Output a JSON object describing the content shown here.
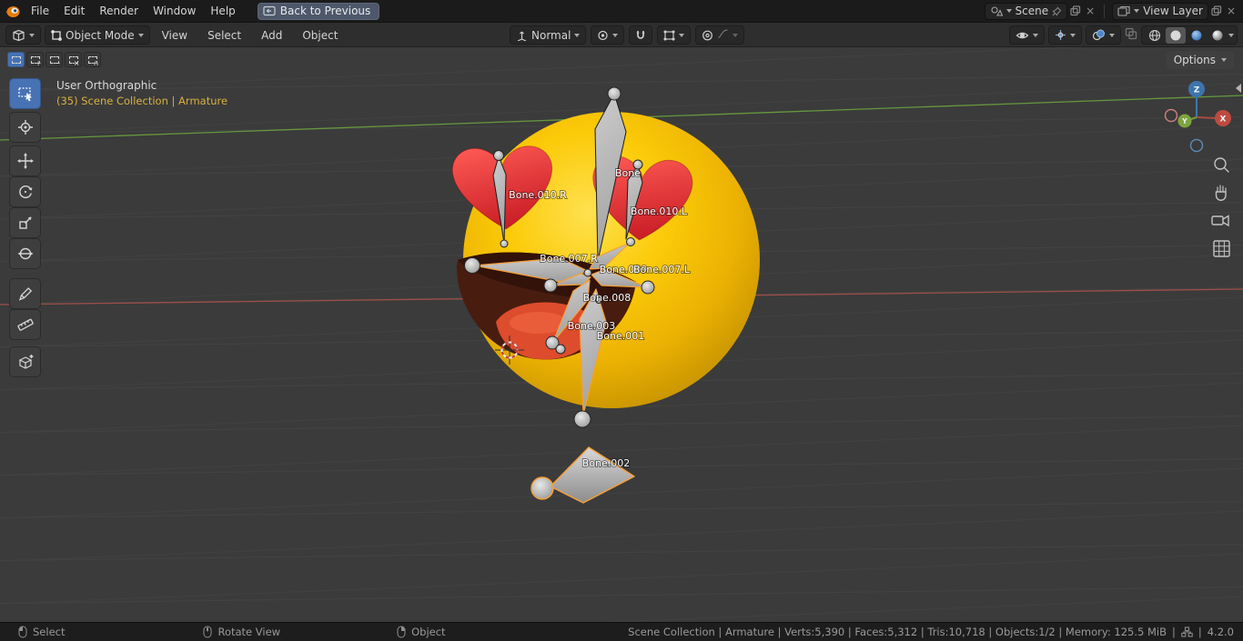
{
  "topbar": {
    "menus": [
      "File",
      "Edit",
      "Render",
      "Window",
      "Help"
    ],
    "back_button": "Back to Previous",
    "scene_label": "Scene",
    "view_layer_label": "View Layer"
  },
  "header": {
    "mode_label": "Object Mode",
    "menus": [
      "View",
      "Select",
      "Add",
      "Object"
    ],
    "orientation_label": "Normal",
    "options_label": "Options"
  },
  "viewport_overlay": {
    "line1": "User Orthographic",
    "line2": "(35) Scene Collection | Armature"
  },
  "bones": {
    "bone": "Bone",
    "b010r": "Bone.010.R",
    "b010l": "Bone.010.L",
    "b007r": "Bone.007.R",
    "b009": "Bone.009",
    "b007l": "Bone.007.L",
    "b008": "Bone.008",
    "b003": "Bone.003",
    "b001": "Bone.001",
    "b002": "Bone.002"
  },
  "gizmo": {
    "z": "Z",
    "x": "X",
    "y": "Y"
  },
  "statusbar": {
    "items": [
      {
        "label": "Select"
      },
      {
        "label": "Rotate View"
      },
      {
        "label": "Object"
      }
    ],
    "stats": "Scene Collection | Armature | Verts:5,390 | Faces:5,312 | Tris:10,718 | Objects:1/2 | Memory: 125.5 MiB",
    "sep": "|",
    "version": "4.2.0"
  },
  "colors": {
    "accent_blue": "#4772b3",
    "selection_orange": "#f59f38",
    "axis_x_red": "#a8514a",
    "axis_y_green": "#69a23f",
    "emoji_yellow": "#f6c60a",
    "heart_red": "#e23a3d",
    "tongue_orange": "#dd4c2c"
  }
}
